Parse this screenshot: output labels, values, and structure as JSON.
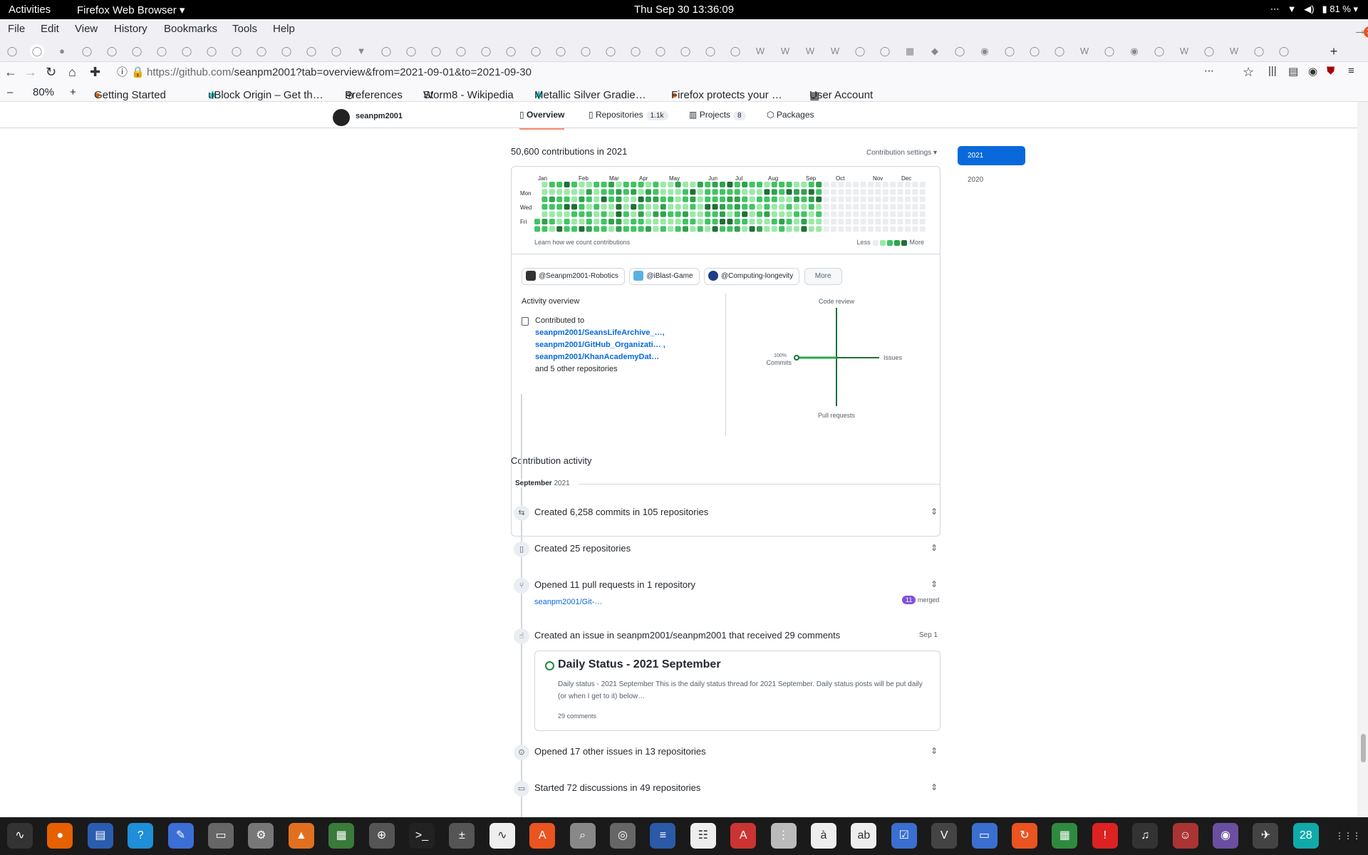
{
  "system": {
    "activities": "Activities",
    "app_menu": "Firefox Web Browser",
    "datetime": "Thu Sep 30  13:36:09",
    "battery": "81 %"
  },
  "menu": [
    "File",
    "Edit",
    "View",
    "History",
    "Bookmarks",
    "Tools",
    "Help"
  ],
  "url": {
    "prefix": "https://github.com/",
    "path": "seanpm2001?tab=overview&from=2021-09-01&to=2021-09-30"
  },
  "zoom": "80%",
  "bookmarks": [
    "Getting Started",
    "uBlock Origin – Get th…",
    "Preferences",
    "Storm8 - Wikipedia",
    "Metallic Silver Gradie…",
    "Firefox protects your …",
    "User Account"
  ],
  "profile": {
    "username": "seanpm2001",
    "tabs": [
      {
        "label": "Overview"
      },
      {
        "label": "Repositories",
        "count": "1.1k"
      },
      {
        "label": "Projects",
        "count": "8"
      },
      {
        "label": "Packages"
      }
    ]
  },
  "contributions": {
    "heading": "50,600 contributions in 2021",
    "settings": "Contribution settings ▾",
    "months": [
      "Jan",
      "Feb",
      "Mar",
      "Apr",
      "May",
      "Jun",
      "Jul",
      "Aug",
      "Sep",
      "Oct",
      "Nov",
      "Dec"
    ],
    "days": [
      "Mon",
      "Wed",
      "Fri"
    ],
    "learn": "Learn how we count contributions",
    "less": "Less",
    "more": "More",
    "colors": [
      "#ebedf0",
      "#9be9a8",
      "#40c463",
      "#30a14e",
      "#216e39"
    ]
  },
  "years": [
    "2021",
    "2020"
  ],
  "orgs": [
    "@Seanpm2001-Robotics",
    "@iBlast-Game",
    "@Computing-longevity"
  ],
  "orgs_more": "More",
  "overview": {
    "title": "Activity overview",
    "contributed": "Contributed to",
    "repos": [
      "seanpm2001/SeansLifeArchive_…,",
      "seanpm2001/GitHub_Organizati… ,",
      "seanpm2001/KhanAcademyDat…"
    ],
    "others": "and 5 other repositories",
    "axes": {
      "top": "Code review",
      "right": "Issues",
      "bottom": "Pull requests",
      "left": "Commits",
      "pct": "100%"
    }
  },
  "activity": {
    "heading": "Contribution activity",
    "month": "September",
    "year": "2021",
    "items": [
      "Created 6,258 commits in 105 repositories",
      "Created 25 repositories",
      "Opened 11 pull requests in 1 repository",
      "Created an issue in seanpm2001/seanpm2001 that received 29 comments",
      "Opened 17 other issues in 13 repositories",
      "Started 72 discussions in 49 repositories"
    ],
    "pr_repo": "seanpm2001/Git-…",
    "pr_count": "11",
    "pr_state": "merged",
    "issue_date": "Sep 1",
    "issue": {
      "title": "Daily Status - 2021 September",
      "body": "Daily status - 2021 September This is the daily status thread for 2021 September. Daily status posts will be put daily (or when I get to it) below…",
      "comments": "29 comments"
    }
  },
  "dock_badge": "28"
}
